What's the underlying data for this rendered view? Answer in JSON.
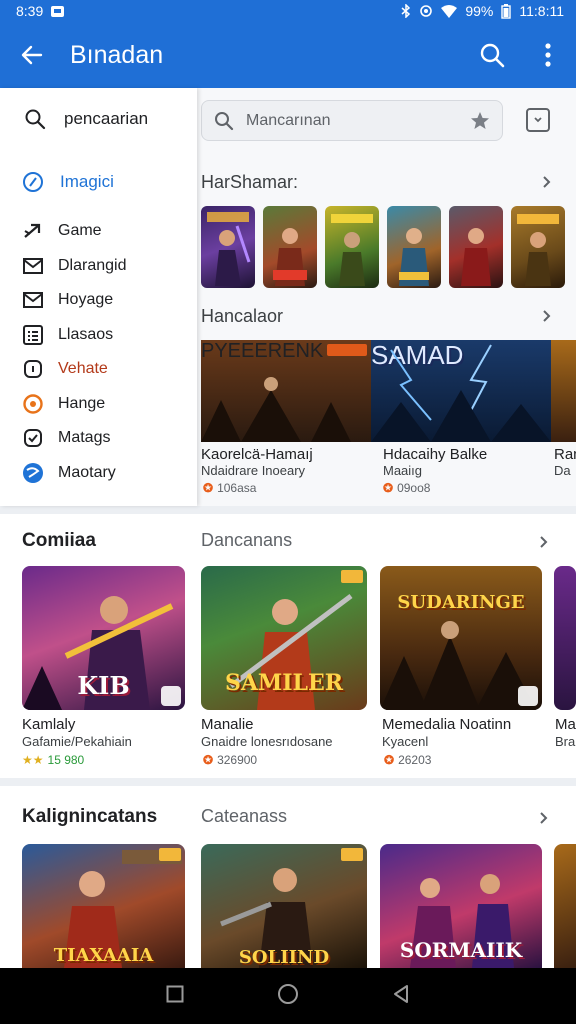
{
  "status_bar": {
    "time_left": "8:39",
    "battery": "99%",
    "time_right": "11:8:11"
  },
  "app_bar": {
    "title": "Bınadan"
  },
  "drawer": {
    "search_label": "pencaarian",
    "selected_label": "Imagici",
    "items": [
      {
        "label": "Game",
        "icon": "arrow-icon",
        "color": "#202124"
      },
      {
        "label": "Dlarangid",
        "icon": "mail-icon",
        "color": "#202124"
      },
      {
        "label": "Hoyage",
        "icon": "mail-icon",
        "color": "#202124"
      },
      {
        "label": "Llasaos",
        "icon": "list-icon",
        "color": "#202124"
      },
      {
        "label": "Vehate",
        "icon": "square-icon",
        "color": "#b33a1a"
      },
      {
        "label": "Hange",
        "icon": "circle-icon",
        "color": "#202124"
      },
      {
        "label": "Matags",
        "icon": "check-icon",
        "color": "#202124"
      },
      {
        "label": "Maotary",
        "icon": "globe-icon",
        "color": "#202124"
      }
    ]
  },
  "search": {
    "placeholder": "Mancarınan"
  },
  "sections": {
    "featured": {
      "label": "HarShamar:"
    },
    "hancalaor": {
      "label": "Hancalaor",
      "cards": [
        {
          "banner_text": "PYEEERENK",
          "title": "Kaorelcä-Hamaıj",
          "subtitle": "Ndaidrare Inoeary",
          "rating": "106asa"
        },
        {
          "banner_text": "SAMAD",
          "title": "Hdacaihy Balke",
          "subtitle": "Maaiıg",
          "rating": "09oo8"
        },
        {
          "banner_text": "",
          "title": "Ran",
          "subtitle": "Da",
          "rating": ""
        }
      ]
    },
    "comiiaa": {
      "title": "Comiiaa",
      "right_label": "Dancanans",
      "cards": [
        {
          "image_text": "KIB",
          "title": "Kamlaly",
          "subtitle": "Gafamie/Pekahiain",
          "rating": "15 980"
        },
        {
          "image_text": "SAMILER",
          "title": "Manalie",
          "subtitle": "Gnaidre lonesrıdosane",
          "rating": "326900"
        },
        {
          "image_text": "SUDARINGE",
          "title": "Memedalia Noatinn",
          "subtitle": "Kyacenl",
          "rating": "26203"
        },
        {
          "image_text": "",
          "title": "Ma",
          "subtitle": "Bra",
          "rating": ""
        }
      ]
    },
    "kalign": {
      "title": "Kalignincatans",
      "right_label": "Cateanass",
      "cards": [
        {
          "image_text": "TIAXAAIA"
        },
        {
          "image_text": "SOLIIND"
        },
        {
          "image_text": "SORMAIIK"
        },
        {
          "image_text": ""
        }
      ]
    }
  },
  "colors": {
    "primary": "#1f6fd6",
    "accent_link": "#1f73d6",
    "rating_orange": "#e85d1a"
  }
}
